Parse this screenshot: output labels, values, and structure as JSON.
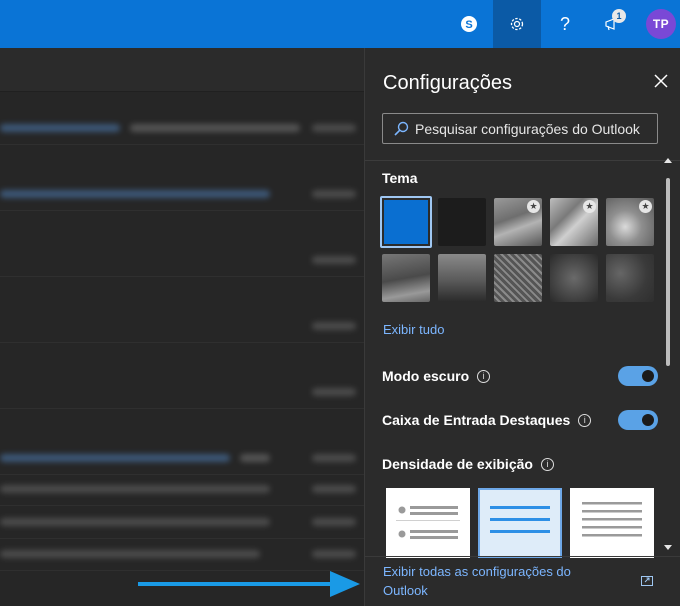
{
  "topbar": {
    "buttons": [
      {
        "name": "skype-icon"
      },
      {
        "name": "gear-icon"
      },
      {
        "name": "help-icon",
        "glyph": "?"
      },
      {
        "name": "announcement-icon",
        "badge": "1"
      }
    ],
    "avatar_initials": "TP",
    "accent": "#0a74d6",
    "avatar_color": "#7a48d6"
  },
  "panel": {
    "title": "Configurações",
    "search_placeholder": "Pesquisar configurações do Outlook",
    "theme": {
      "label": "Tema",
      "view_all": "Exibir tudo",
      "tiles": [
        {
          "name": "theme-blue",
          "selected": true
        },
        {
          "name": "theme-black"
        },
        {
          "name": "theme-flag",
          "starred": true
        },
        {
          "name": "theme-flag-2",
          "starred": true
        },
        {
          "name": "theme-floral",
          "starred": true
        },
        {
          "name": "theme-mountain"
        },
        {
          "name": "theme-palms"
        },
        {
          "name": "theme-circuit"
        },
        {
          "name": "theme-coin"
        },
        {
          "name": "theme-dark-sparkle"
        },
        {
          "name": "theme-glow"
        }
      ]
    },
    "dark_mode": {
      "label": "Modo escuro",
      "on": true
    },
    "focused_inbox": {
      "label": "Caixa de Entrada Destaques",
      "on": true
    },
    "density": {
      "label": "Densidade de exibição",
      "selected_index": 1
    },
    "footer_link": "Exibir todas as configurações do Outlook"
  }
}
